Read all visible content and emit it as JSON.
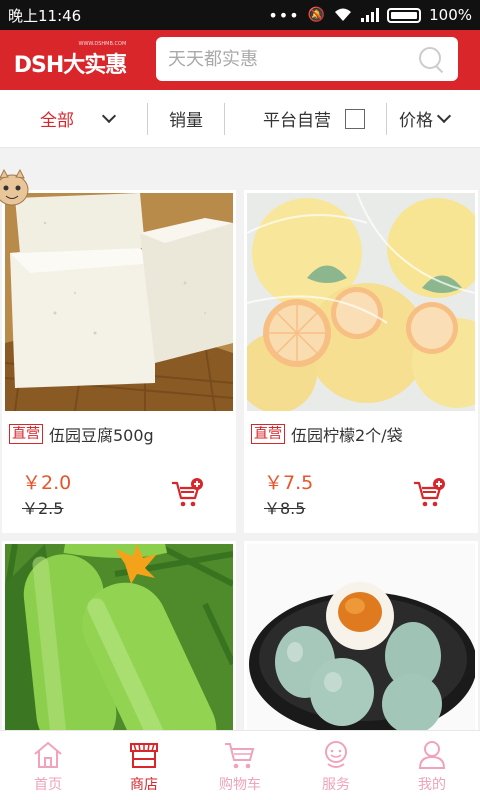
{
  "status_bar": {
    "time": "晚上11:46",
    "battery": "100%"
  },
  "header": {
    "logo_text": "DSH大实惠",
    "logo_sub": "WWW.DSHMB.COM",
    "search": {
      "placeholder": "天天都实惠"
    }
  },
  "filters": {
    "all_label": "全部",
    "sales_label": "销量",
    "self_run_label": "平台自营",
    "price_label": "价格"
  },
  "products": [
    {
      "badge": "直营",
      "name": "伍园豆腐500g",
      "price": "￥2.0",
      "old_price": "￥2.5",
      "image": "tofu"
    },
    {
      "badge": "直营",
      "name": "伍园柠檬2个/袋",
      "price": "￥7.5",
      "old_price": "￥8.5",
      "image": "lemon"
    },
    {
      "badge": "",
      "name": "",
      "price": "",
      "old_price": "",
      "image": "zucchini"
    },
    {
      "badge": "",
      "name": "",
      "price": "",
      "old_price": "",
      "image": "eggs"
    }
  ],
  "tabbar": [
    {
      "label": "首页",
      "icon": "home-icon"
    },
    {
      "label": "商店",
      "icon": "shop-icon"
    },
    {
      "label": "购物车",
      "icon": "cart-icon"
    },
    {
      "label": "服务",
      "icon": "service-icon"
    },
    {
      "label": "我的",
      "icon": "user-icon"
    }
  ],
  "colors": {
    "brand": "#d8262b",
    "price": "#e8552b",
    "tab_inactive": "#f0a3bb"
  }
}
